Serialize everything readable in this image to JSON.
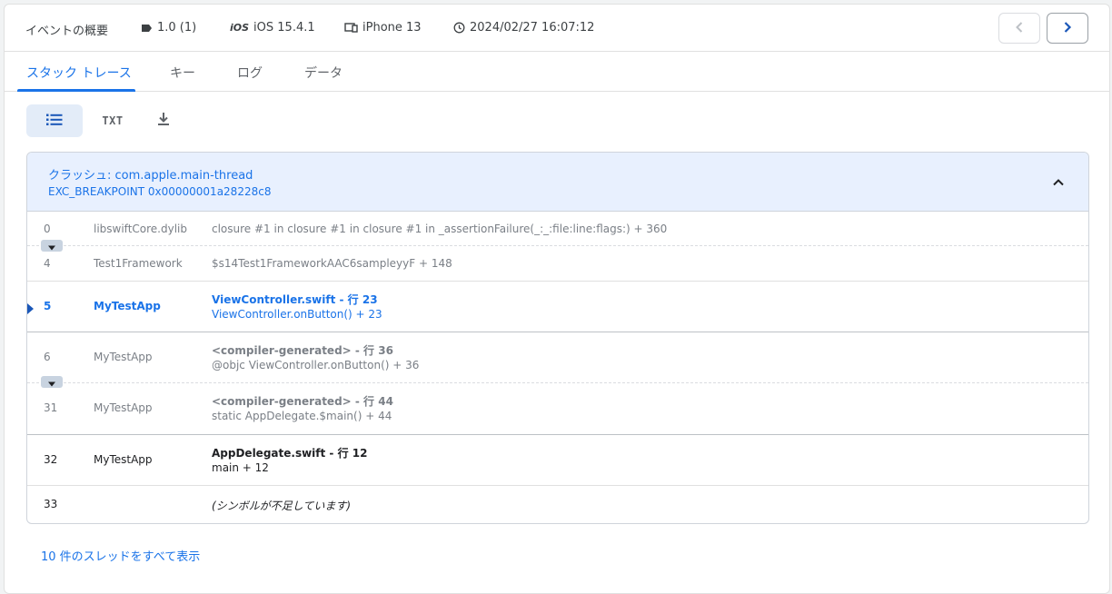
{
  "header": {
    "title": "イベントの概要",
    "version": "1.0 (1)",
    "os_badge": "iOS",
    "os": "iOS 15.4.1",
    "device": "iPhone 13",
    "timestamp": "2024/02/27 16:07:12",
    "icons": [
      "label-icon",
      "ios-icon",
      "device-icon",
      "clock-icon",
      "chevron-left-icon",
      "chevron-right-icon"
    ]
  },
  "tabs": [
    {
      "label": "スタック トレース",
      "active": true
    },
    {
      "label": "キー",
      "active": false
    },
    {
      "label": "ログ",
      "active": false
    },
    {
      "label": "データ",
      "active": false
    }
  ],
  "toolbar": {
    "list_view": "list-icon",
    "txt_label": "TXT",
    "download": "download-icon"
  },
  "crash": {
    "prefix": "クラッシュ: ",
    "thread": "com.apple.main-thread",
    "exception": "EXC_BREAKPOINT 0x00000001a28228c8"
  },
  "frames": [
    {
      "num": "0",
      "lib": "libswiftCore.dylib",
      "title": "",
      "sym": "closure #1 in closure #1 in closure #1 in _assertionFailure(_:_:file:line:flags:) + 360"
    },
    {
      "num": "4",
      "lib": "Test1Framework",
      "title": "",
      "sym": "$s14Test1FrameworkAAC6sampleyyF + 148"
    },
    {
      "num": "5",
      "lib": "MyTestApp",
      "title": "ViewController.swift - 行 23",
      "sym": "ViewController.onButton() + 23"
    },
    {
      "num": "6",
      "lib": "MyTestApp",
      "title": "<compiler-generated> - 行 36",
      "sym": "@objc ViewController.onButton() + 36"
    },
    {
      "num": "31",
      "lib": "MyTestApp",
      "title": "<compiler-generated> - 行 44",
      "sym": "static AppDelegate.$main() + 44"
    },
    {
      "num": "32",
      "lib": "MyTestApp",
      "title": "AppDelegate.swift - 行 12",
      "sym": "main + 12"
    },
    {
      "num": "33",
      "lib": "",
      "title": "",
      "sym": "(シンボルが不足しています)"
    }
  ],
  "footer": {
    "show_threads": "10 件のスレッドをすべて表示"
  },
  "colors": {
    "accent": "#1a73e8",
    "header_bg": "#e8f0fe",
    "text_dark": "#202124",
    "text_muted": "#5f6368"
  }
}
